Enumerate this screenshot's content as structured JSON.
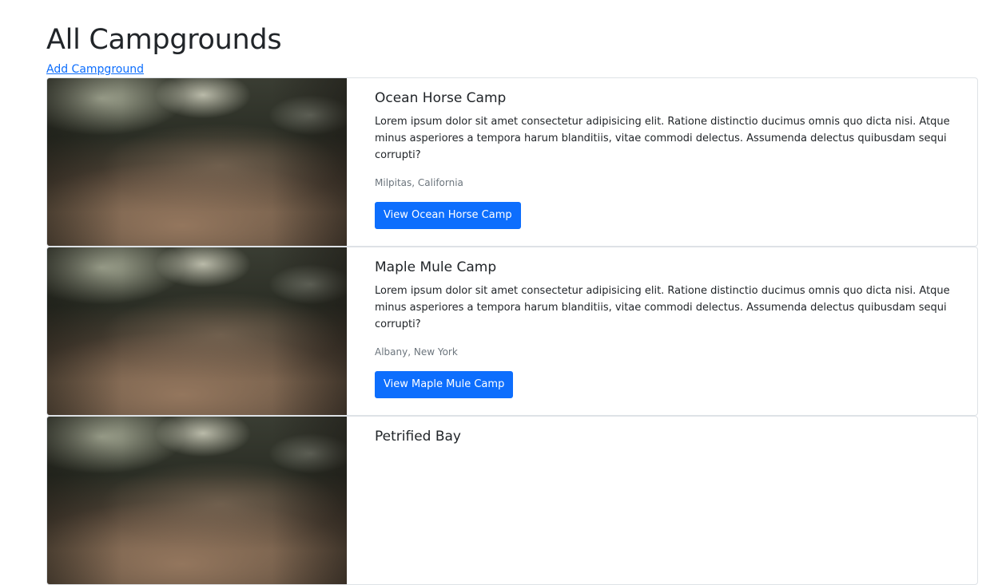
{
  "header": {
    "title": "All Campgrounds",
    "add_link": "Add Campground"
  },
  "campgrounds": [
    {
      "title": "Ocean Horse Camp",
      "description": "Lorem ipsum dolor sit amet consectetur adipisicing elit. Ratione distinctio ducimus omnis quo dicta nisi. Atque minus asperiores a tempora harum blanditiis, vitae commodi delectus. Assumenda delectus quibusdam sequi corrupti?",
      "location": "Milpitas, California",
      "button_label": "View Ocean Horse Camp"
    },
    {
      "title": "Maple Mule Camp",
      "description": "Lorem ipsum dolor sit amet consectetur adipisicing elit. Ratione distinctio ducimus omnis quo dicta nisi. Atque minus asperiores a tempora harum blanditiis, vitae commodi delectus. Assumenda delectus quibusdam sequi corrupti?",
      "location": "Albany, New York",
      "button_label": "View Maple Mule Camp"
    },
    {
      "title": "Petrified Bay"
    }
  ],
  "colors": {
    "primary": "#0d6efd",
    "muted": "#6c757d",
    "text": "#212529",
    "border": "#dee2e6"
  }
}
